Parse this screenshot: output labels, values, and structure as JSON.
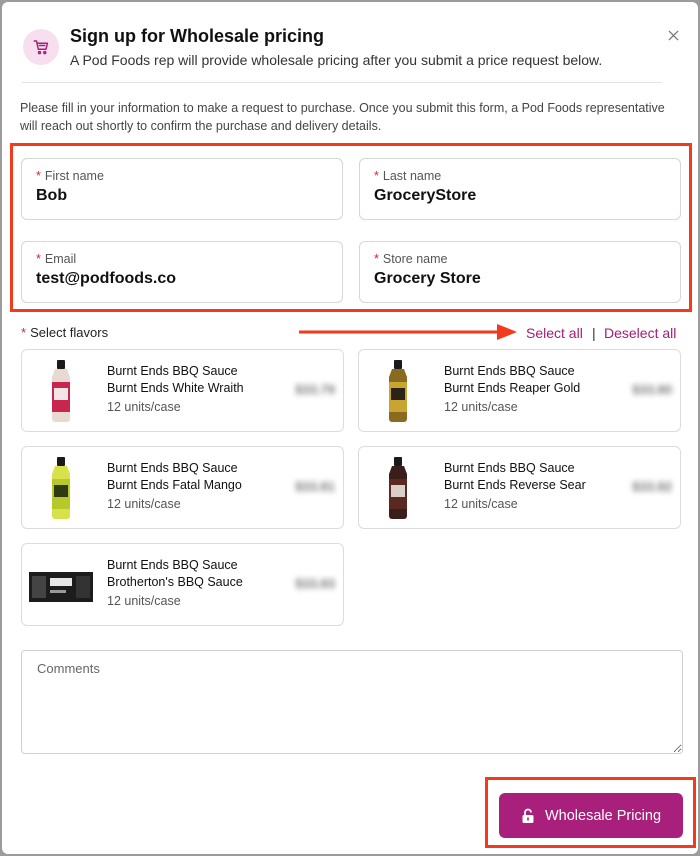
{
  "header": {
    "title": "Sign up for Wholesale pricing",
    "subtitle": "A Pod Foods rep will provide wholesale pricing after you submit a price request below.",
    "icon": "shopping-cart-icon",
    "close_icon": "close-icon"
  },
  "intro": "Please fill in your information to make a request to purchase. Once you submit this form, a Pod Foods representative will reach out shortly to confirm the purchase and delivery details.",
  "form": {
    "required_marker": "*",
    "first_name": {
      "label": "First name",
      "value": "Bob"
    },
    "last_name": {
      "label": "Last name",
      "value": "GroceryStore"
    },
    "email": {
      "label": "Email",
      "value": "test@podfoods.co"
    },
    "store_name": {
      "label": "Store name",
      "value": "Grocery Store"
    }
  },
  "flavors": {
    "label": "Select flavors",
    "select_all": "Select all",
    "separator": "|",
    "deselect_all": "Deselect all",
    "items": [
      {
        "brand": "Burnt Ends BBQ Sauce",
        "name": "Burnt Ends White Wraith",
        "units": "12 units/case",
        "price": "$33.79"
      },
      {
        "brand": "Burnt Ends BBQ Sauce",
        "name": "Burnt Ends Reaper Gold",
        "units": "12 units/case",
        "price": "$33.80"
      },
      {
        "brand": "Burnt Ends BBQ Sauce",
        "name": "Burnt Ends Fatal Mango",
        "units": "12 units/case",
        "price": "$33.81"
      },
      {
        "brand": "Burnt Ends BBQ Sauce",
        "name": "Burnt Ends Reverse Sear",
        "units": "12 units/case",
        "price": "$33.82"
      },
      {
        "brand": "Burnt Ends BBQ Sauce",
        "name": "Brotherton's BBQ Sauce",
        "units": "12 units/case",
        "price": "$33.83"
      }
    ]
  },
  "comments": {
    "placeholder": "Comments"
  },
  "submit": {
    "label": "Wholesale Pricing",
    "icon": "unlock-icon"
  },
  "colors": {
    "accent": "#a91f7c",
    "highlight": "#f23b1d",
    "required": "#d2292f"
  }
}
